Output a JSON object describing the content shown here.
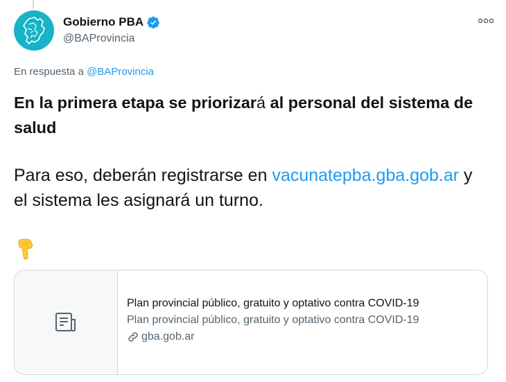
{
  "author": {
    "display_name": "Gobierno PBA",
    "handle": "@BAProvincia",
    "avatar_color": "#17b3c7",
    "verified_icon": "verified-badge-icon"
  },
  "more_label": "ooo",
  "reply": {
    "prefix": "En respuesta a",
    "mention": "@BAProvincia"
  },
  "tweet": {
    "bold_part1": "En la primera etapa se priorizar",
    "plain_char": "á",
    "bold_part2": " al personal del sistema de salud",
    "body_before_link": "Para eso, deberán registrarse en ",
    "link": "vacunatepba.gba.gob.ar",
    "body_after_link": " y el sistema les asignará un turno.",
    "emoji": "pointing-down-hand"
  },
  "card": {
    "thumb_icon": "document-icon",
    "title": "Plan provincial público, gratuito y optativo contra COVID-19",
    "description": "Plan provincial público, gratuito y optativo contra COVID-19",
    "domain": "gba.gob.ar",
    "domain_icon": "link-icon"
  },
  "colors": {
    "link": "#1d9bf0",
    "secondary_text": "#536471",
    "border": "#cfd9de"
  }
}
